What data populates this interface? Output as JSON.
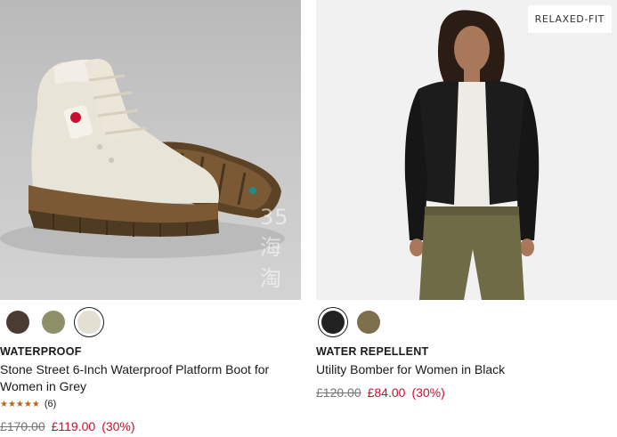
{
  "products": [
    {
      "feature": "WATERPROOF",
      "title": "Stone Street 6-Inch Waterproof Platform Boot for Women in Grey",
      "rating_count": "(6)",
      "stars": "★★★★★",
      "rating_value": 5,
      "old_price": "£170.00",
      "new_price": "£119.00",
      "discount": "(30%)",
      "swatches": [
        {
          "color": "#4a3b33",
          "selected": false
        },
        {
          "color": "#8c8f67",
          "selected": false
        },
        {
          "color": "#e4dfd3",
          "selected": true
        }
      ]
    },
    {
      "badge": "RELAXED-FIT",
      "feature": "WATER REPELLENT",
      "title": "Utility Bomber for Women in Black",
      "old_price": "£120.00",
      "new_price": "£84.00",
      "discount": "(30%)",
      "swatches": [
        {
          "color": "#222222",
          "selected": true
        },
        {
          "color": "#7d6e4c",
          "selected": false
        }
      ]
    }
  ],
  "watermark": "35海淘"
}
